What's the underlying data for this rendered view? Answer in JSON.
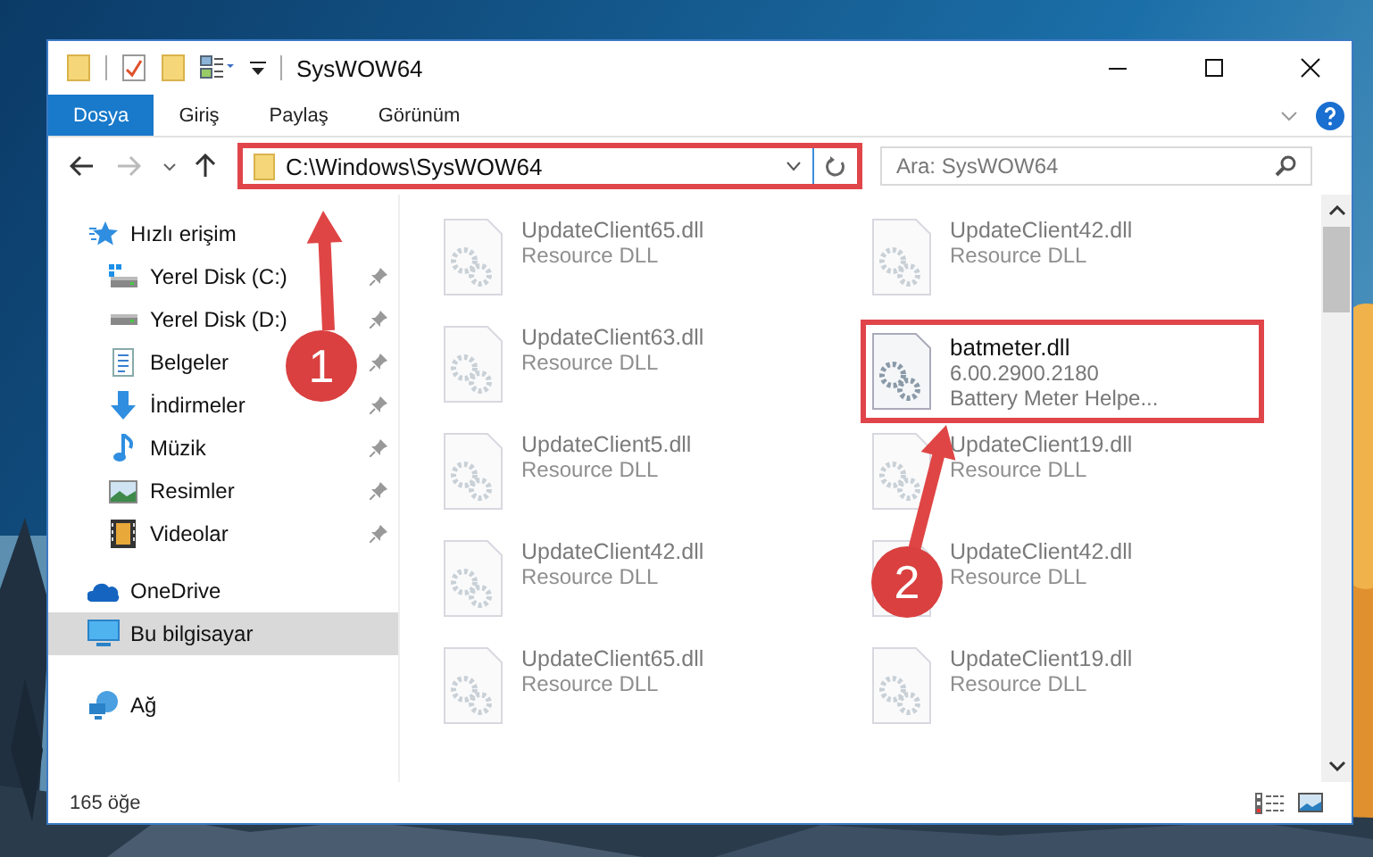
{
  "window": {
    "title": "SysWOW64"
  },
  "ribbon_tabs": [
    {
      "label": "Dosya",
      "selected": true
    },
    {
      "label": "Giriş",
      "selected": false
    },
    {
      "label": "Paylaş",
      "selected": false
    },
    {
      "label": "Görünüm",
      "selected": false
    }
  ],
  "address_bar": {
    "path": "C:\\Windows\\SysWOW64",
    "highlighted": true
  },
  "search": {
    "placeholder": "Ara: SysWOW64"
  },
  "sidebar": {
    "items": [
      {
        "label": "Hızlı erişim",
        "kind": "star",
        "selected": false,
        "children": [
          {
            "label": "Yerel Disk (C:)",
            "kind": "drive-c",
            "pinned": true,
            "selected": false
          },
          {
            "label": "Yerel Disk (D:)",
            "kind": "drive",
            "pinned": true,
            "selected": false
          },
          {
            "label": "Belgeler",
            "kind": "documents",
            "pinned": true,
            "selected": false
          },
          {
            "label": "İndirmeler",
            "kind": "downloads",
            "pinned": true,
            "selected": false
          },
          {
            "label": "Müzik",
            "kind": "music",
            "pinned": true,
            "selected": false
          },
          {
            "label": "Resimler",
            "kind": "pictures",
            "pinned": true,
            "selected": false
          },
          {
            "label": "Videolar",
            "kind": "videos",
            "pinned": true,
            "selected": false
          }
        ]
      },
      {
        "label": "OneDrive",
        "kind": "cloud",
        "selected": false
      },
      {
        "label": "Bu bilgisayar",
        "kind": "computer",
        "selected": true
      },
      {
        "label": "Ağ",
        "kind": "network",
        "selected": false
      }
    ]
  },
  "files": [
    {
      "name": "UpdateClient65.dll",
      "lines": [
        "Resource DLL"
      ],
      "highlighted": false
    },
    {
      "name": "UpdateClient42.dll",
      "lines": [
        "Resource DLL"
      ],
      "highlighted": false
    },
    {
      "name": "UpdateClient63.dll",
      "lines": [
        "Resource DLL"
      ],
      "highlighted": false
    },
    {
      "name": "batmeter.dll",
      "lines": [
        "6.00.2900.2180",
        "Battery Meter Helpe..."
      ],
      "highlighted": true
    },
    {
      "name": "UpdateClient5.dll",
      "lines": [
        "Resource DLL"
      ],
      "highlighted": false
    },
    {
      "name": "UpdateClient19.dll",
      "lines": [
        "Resource DLL"
      ],
      "highlighted": false
    },
    {
      "name": "UpdateClient42.dll",
      "lines": [
        "Resource DLL"
      ],
      "highlighted": false
    },
    {
      "name": "UpdateClient42.dll",
      "lines": [
        "Resource DLL"
      ],
      "highlighted": false
    },
    {
      "name": "UpdateClient65.dll",
      "lines": [
        "Resource DLL"
      ],
      "highlighted": false
    },
    {
      "name": "UpdateClient19.dll",
      "lines": [
        "Resource DLL"
      ],
      "highlighted": false
    }
  ],
  "annotations": [
    {
      "label": "1"
    },
    {
      "label": "2"
    }
  ],
  "status_bar": {
    "count": "165 öğe"
  }
}
